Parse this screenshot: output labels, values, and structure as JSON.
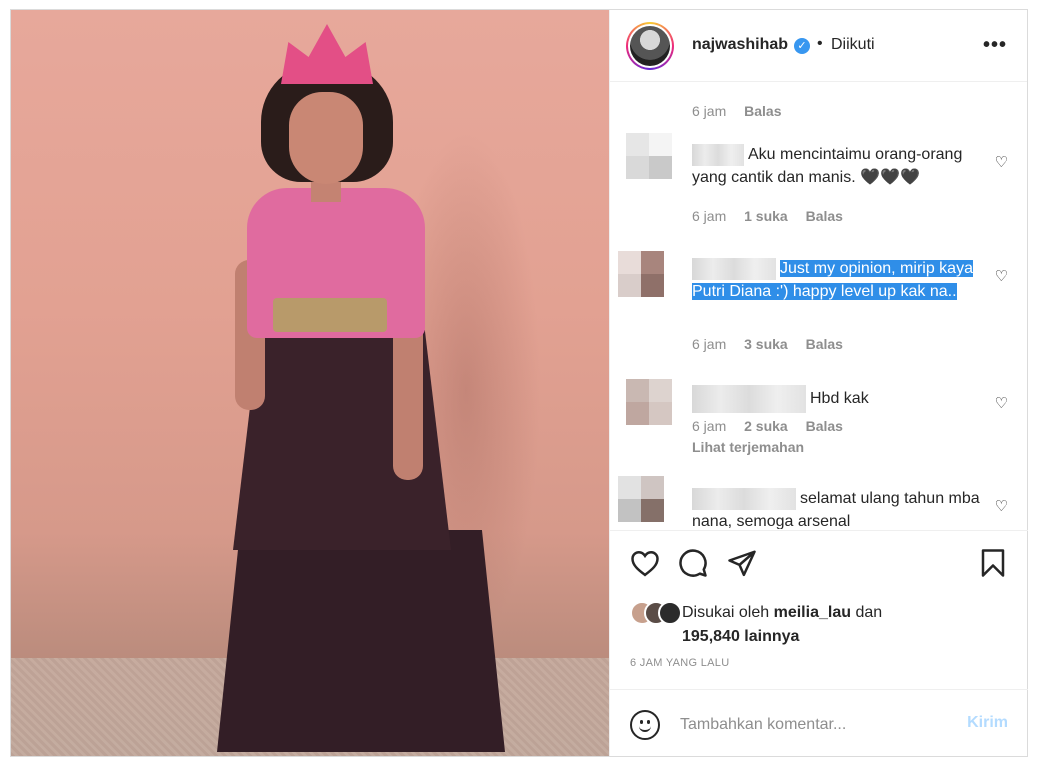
{
  "post": {
    "username": "najwashihab",
    "separator": "•",
    "follow_status": "Diikuti",
    "more_label": "•••"
  },
  "comments": [
    {
      "meta": {
        "time": "6 jam",
        "reply": "Balas"
      }
    },
    {
      "text": "Aku mencintaimu orang-orang yang cantik dan manis. 🖤🖤🖤",
      "time": "6 jam",
      "likes": "1 suka",
      "reply": "Balas"
    },
    {
      "text": "Just my opinion, mirip kaya Putri Diana :') happy level up kak na..",
      "time": "6 jam",
      "likes": "3 suka",
      "reply": "Balas"
    },
    {
      "text": "Hbd kak",
      "time": "6 jam",
      "likes": "2 suka",
      "reply": "Balas",
      "translate": "Lihat terjemahan"
    },
    {
      "text": "selamat ulang tahun mba nana, semoga arsenal"
    }
  ],
  "likes": {
    "prefix": "Disukai oleh",
    "user": "meilia_lau",
    "conj": "dan",
    "count": "195,840 lainnya"
  },
  "time_ago": "6 JAM YANG LALU",
  "add_comment": {
    "placeholder": "Tambahkan komentar...",
    "post_label": "Kirim"
  },
  "icons": [
    "heart-icon",
    "comment-icon",
    "share-icon",
    "bookmark-icon",
    "emoji-icon",
    "verified-icon",
    "more-icon"
  ],
  "colors": {
    "highlight": "#2f8ee8",
    "verified": "#3897f0",
    "post_button_disabled": "#b3dbff"
  }
}
